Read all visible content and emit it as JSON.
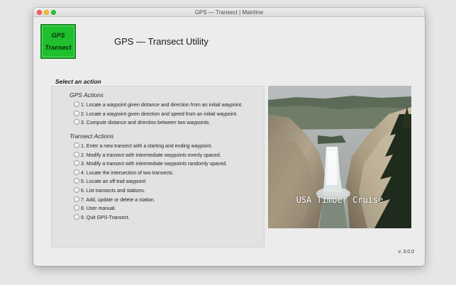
{
  "window": {
    "title": "GPS — Transect | Mainline"
  },
  "logo": {
    "line1": "GPS",
    "line2": "Transect"
  },
  "header": {
    "title": "GPS — Transect Utility"
  },
  "actions": {
    "label": "Select an action",
    "gps_group": {
      "title": "GPS Actions",
      "options": [
        "1. Locate a waypoint given distance and direction from an initial waypoint.",
        "2. Locate a waypoint given direction and speed from an initial waypoint.",
        "3. Compute distance and direction between two waypoints."
      ]
    },
    "transect_group": {
      "title": "Transect Actions",
      "options": [
        "1. Enter a new transect with a starting and ending waypoint.",
        "2. Modify a transect with intermediate waypoints evenly spaced.",
        "3. Modify a transect with intermediate waypoints randomly spaced.",
        "4. Locate the intersection of two transects.",
        "5. Locate an off-trail waypoint",
        "6. List transects and stations.",
        "7. Add, update or delete a station.",
        "8. User manual.",
        "9. Quit GPS-Transect."
      ]
    }
  },
  "photo": {
    "caption": "USA Timber Cruise"
  },
  "footer": {
    "version": "v. 3.0.0"
  },
  "colors": {
    "logo_green": "#1fbf2e",
    "close": "#ff5f57",
    "minimize": "#febc2e",
    "maximize": "#28c840"
  },
  "icons": {
    "close": "close-icon",
    "minimize": "minimize-icon",
    "maximize": "maximize-icon",
    "radio": "radio-button-icon"
  }
}
